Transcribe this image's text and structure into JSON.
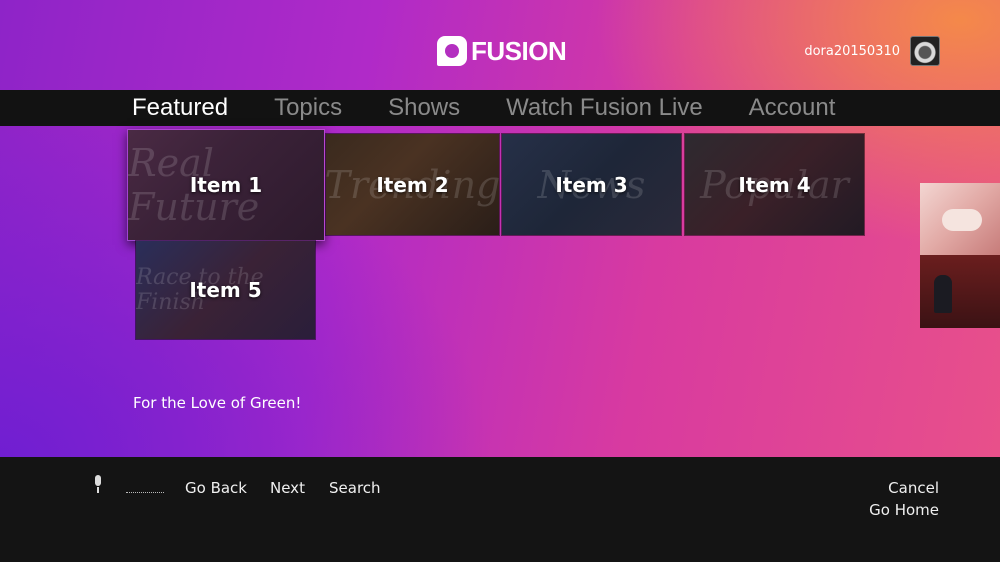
{
  "app": {
    "logo_text": "FUSION",
    "username": "dora20150310"
  },
  "nav": {
    "items": [
      {
        "label": "Featured",
        "active": true
      },
      {
        "label": "Topics",
        "active": false
      },
      {
        "label": "Shows",
        "active": false
      },
      {
        "label": "Watch Fusion Live",
        "active": false
      },
      {
        "label": "Account",
        "active": false
      }
    ]
  },
  "tiles": [
    {
      "label": "Item 1",
      "script": "Real Future",
      "focused": true
    },
    {
      "label": "Item 2",
      "script": "Trending",
      "focused": false
    },
    {
      "label": "Item 3",
      "script": "News",
      "focused": false
    },
    {
      "label": "Item 4",
      "script": "Popular",
      "focused": false
    },
    {
      "label": "Item 5",
      "script": "Race to the Finish",
      "focused": false
    }
  ],
  "selected_title": "For the Love of Green!",
  "voice_commands": {
    "left": [
      "Go Back",
      "Next",
      "Search"
    ],
    "right": [
      "Cancel",
      "Go Home"
    ]
  },
  "colors": {
    "bg_purple": "#8e24c8",
    "bg_pink": "#e8508a",
    "bg_orange": "#f58c46",
    "nav_bar": "#121212",
    "bottom_bar": "#141414"
  }
}
